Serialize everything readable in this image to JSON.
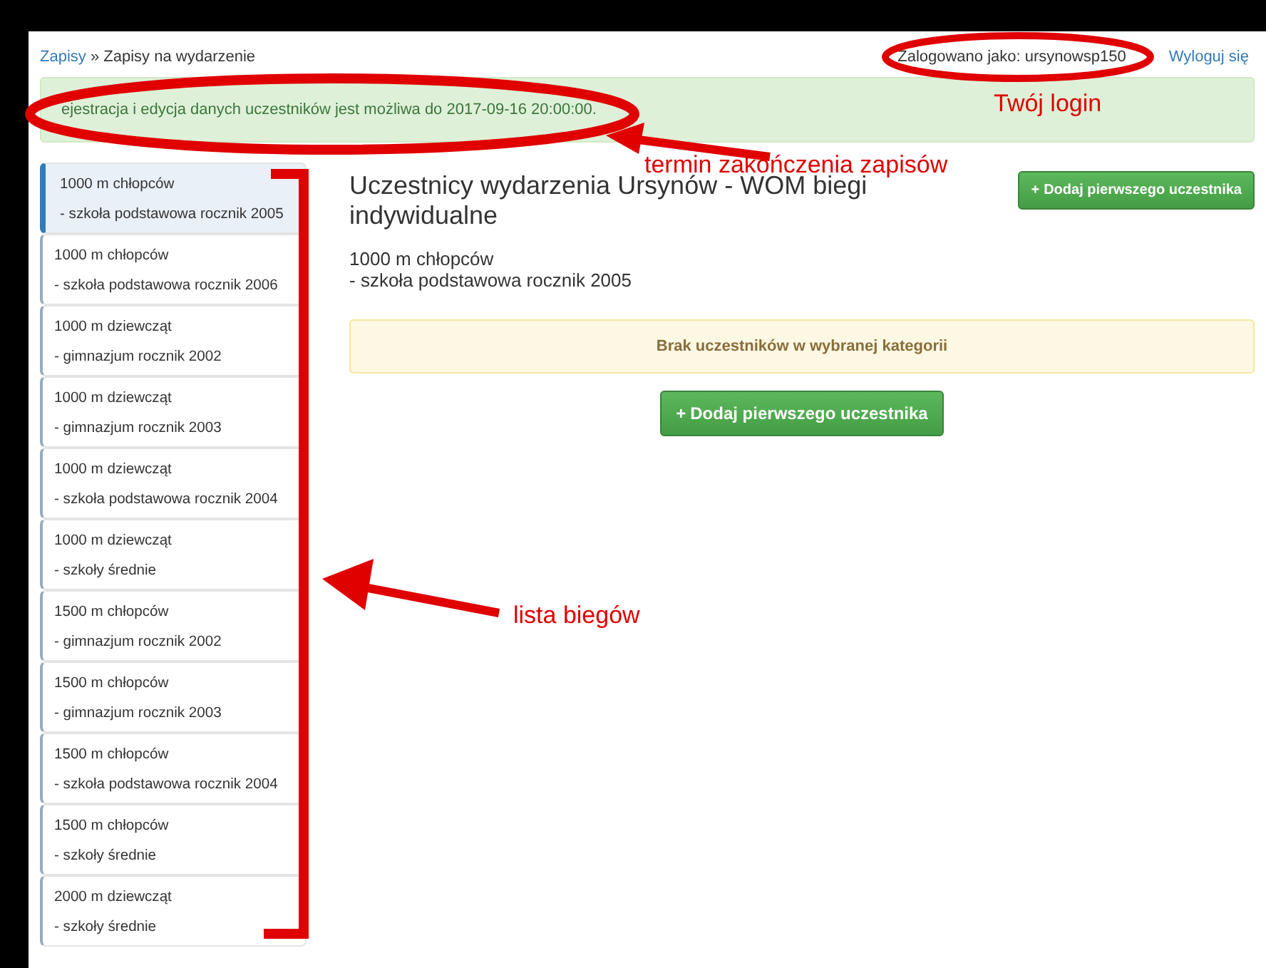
{
  "breadcrumb": {
    "link": "Zapisy",
    "separator": "»",
    "current": "Zapisy na wydarzenie"
  },
  "user": {
    "label": "Zalogowano jako:",
    "login": "ursynowsp150",
    "logout": "Wyloguj się"
  },
  "alert": {
    "text": "ejestracja i edycja danych uczestników jest możliwa do 2017-09-16 20:00:00."
  },
  "races": [
    {
      "name": "1000 m chłopców",
      "category": "- szkoła podstawowa rocznik 2005",
      "selected": true
    },
    {
      "name": "1000 m chłopców",
      "category": "- szkoła podstawowa rocznik 2006",
      "selected": false
    },
    {
      "name": "1000 m dziewcząt",
      "category": "- gimnazjum rocznik 2002",
      "selected": false
    },
    {
      "name": "1000 m dziewcząt",
      "category": "- gimnazjum rocznik 2003",
      "selected": false
    },
    {
      "name": "1000 m dziewcząt",
      "category": "- szkoła podstawowa rocznik 2004",
      "selected": false
    },
    {
      "name": "1000 m dziewcząt",
      "category": "- szkoły średnie",
      "selected": false
    },
    {
      "name": "1500 m chłopców",
      "category": "- gimnazjum rocznik 2002",
      "selected": false
    },
    {
      "name": "1500 m chłopców",
      "category": "- gimnazjum rocznik 2003",
      "selected": false
    },
    {
      "name": "1500 m chłopców",
      "category": "- szkoła podstawowa rocznik 2004",
      "selected": false
    },
    {
      "name": "1500 m chłopców",
      "category": "- szkoły średnie",
      "selected": false
    },
    {
      "name": "2000 m dziewcząt",
      "category": "- szkoły średnie",
      "selected": false
    }
  ],
  "main": {
    "title": "Uczestnicy wydarzenia Ursynów - WOM biegi indywidualne",
    "subtitle": [
      "1000 m chłopców",
      "- szkoła podstawowa rocznik 2005"
    ],
    "header_button": {
      "icon": "+",
      "label": "Dodaj pierwszego uczestnika"
    },
    "empty_notice": "Brak uczestników w wybranej kategorii",
    "center_button": {
      "icon": "+",
      "label": "Dodaj pierwszego uczestnika"
    }
  },
  "annotations": {
    "login_label": "Twój login",
    "deadline_label": "termin zakończenia zapisów",
    "list_label": "lista biegów"
  }
}
